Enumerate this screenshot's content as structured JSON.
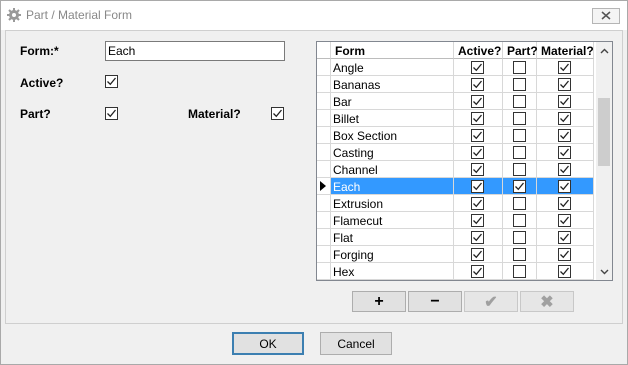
{
  "window": {
    "title": "Part / Material Form"
  },
  "form": {
    "form_label": "Form:*",
    "form_value": "Each",
    "active_label": "Active?",
    "active_checked": true,
    "part_label": "Part?",
    "part_checked": true,
    "material_label": "Material?",
    "material_checked": true
  },
  "grid": {
    "columns": [
      "Form",
      "Active?",
      "Part?",
      "Material?"
    ],
    "selected_index": 7,
    "rows": [
      {
        "form": "Angle",
        "active": true,
        "part": false,
        "material": true
      },
      {
        "form": "Bananas",
        "active": true,
        "part": false,
        "material": true
      },
      {
        "form": "Bar",
        "active": true,
        "part": false,
        "material": true
      },
      {
        "form": "Billet",
        "active": true,
        "part": false,
        "material": true
      },
      {
        "form": "Box Section",
        "active": true,
        "part": false,
        "material": true
      },
      {
        "form": "Casting",
        "active": true,
        "part": false,
        "material": true
      },
      {
        "form": "Channel",
        "active": true,
        "part": false,
        "material": true
      },
      {
        "form": "Each",
        "active": true,
        "part": true,
        "material": true
      },
      {
        "form": "Extrusion",
        "active": true,
        "part": false,
        "material": true
      },
      {
        "form": "Flamecut",
        "active": true,
        "part": false,
        "material": true
      },
      {
        "form": "Flat",
        "active": true,
        "part": false,
        "material": true
      },
      {
        "form": "Forging",
        "active": true,
        "part": false,
        "material": true
      },
      {
        "form": "Hex",
        "active": true,
        "part": false,
        "material": true
      }
    ]
  },
  "nav": {
    "add_label": "+",
    "remove_label": "−",
    "confirm_label": "✔",
    "cancel_label": "✖"
  },
  "buttons": {
    "ok_label": "OK",
    "cancel_label": "Cancel"
  },
  "icons": {
    "title_icon": "gear-icon",
    "close_icon": "close-icon",
    "scroll_up": "chevron-up-icon",
    "scroll_down": "chevron-down-icon",
    "row_pointer": "row-pointer-icon"
  }
}
